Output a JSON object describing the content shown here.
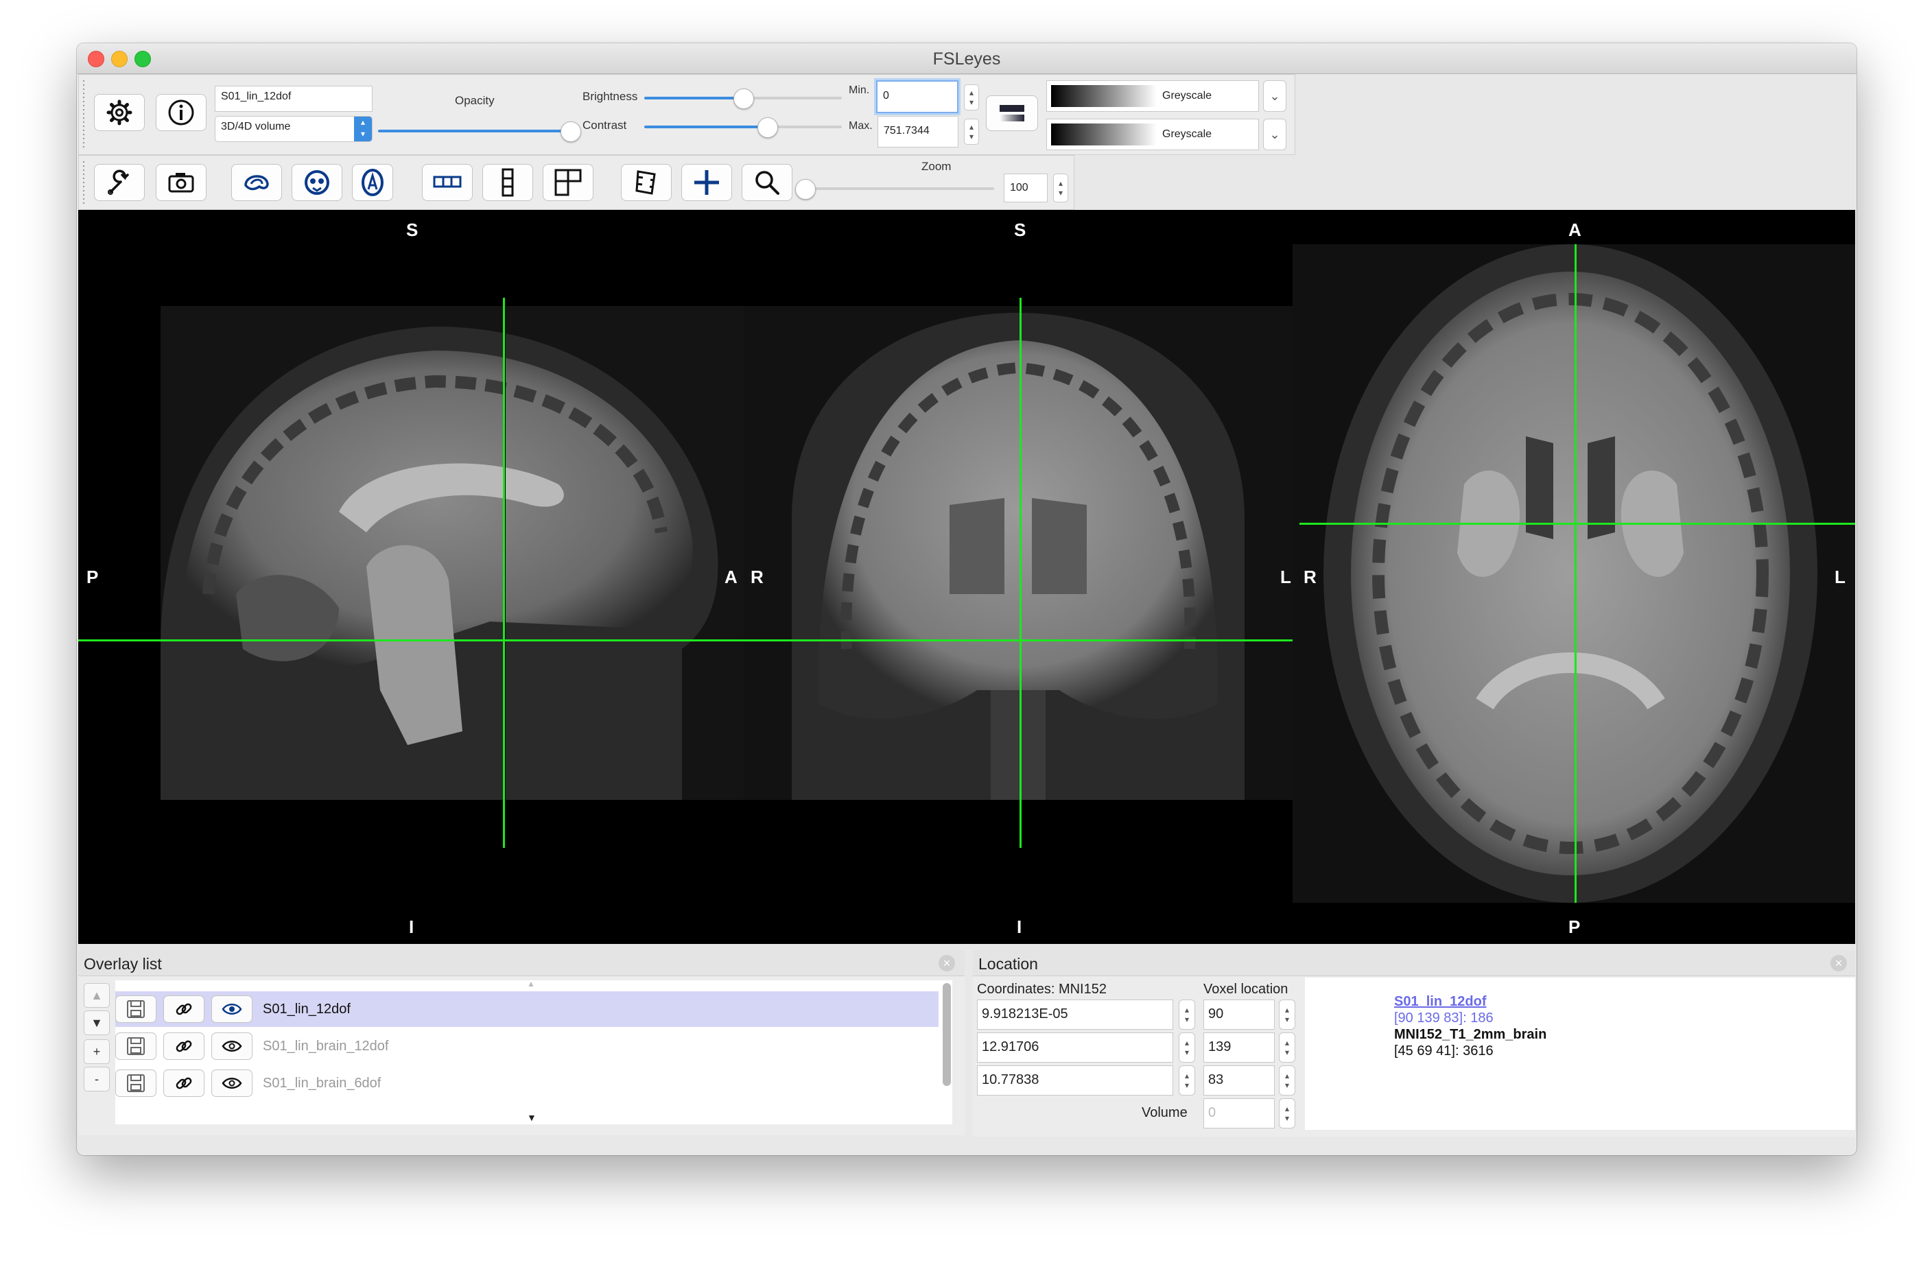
{
  "window": {
    "title": "FSLeyes"
  },
  "overlay_toolbar": {
    "overlay_name": "S01_lin_12dof",
    "overlay_type": "3D/4D volume",
    "opacity_label": "Opacity",
    "opacity_level": 1.0,
    "brightness_label": "Brightness",
    "brightness_level": 0.5,
    "contrast_label": "Contrast",
    "contrast_level": 0.62,
    "min_label": "Min.",
    "min_value": "0",
    "max_label": "Max.",
    "max_value": "751.7344",
    "cmap1": "Greyscale",
    "cmap2": "Greyscale"
  },
  "view_toolbar": {
    "zoom_label": "Zoom",
    "zoom_value": "100",
    "zoom_level": 0.0,
    "icons": [
      "wrench-icon",
      "camera-icon",
      "sagittal-icon",
      "coronal-icon",
      "axial-icon",
      "horizontal-layout-icon",
      "vertical-layout-icon",
      "grid-layout-icon",
      "movie-icon",
      "crosshair-icon",
      "zoom-icon"
    ]
  },
  "views": {
    "sagittal": {
      "top": "S",
      "bottom": "I",
      "left": "P",
      "right": "A"
    },
    "coronal": {
      "top": "S",
      "bottom": "I",
      "left": "R",
      "right": "L"
    },
    "axial": {
      "top": "A",
      "bottom": "P",
      "left": "R",
      "right": "L"
    }
  },
  "overlay_list": {
    "title": "Overlay list",
    "items": [
      {
        "name": "S01_lin_12dof",
        "selected": true
      },
      {
        "name": "S01_lin_brain_12dof",
        "selected": false
      },
      {
        "name": "S01_lin_brain_6dof",
        "selected": false
      }
    ],
    "side_buttons": [
      "▲",
      "▼",
      "+",
      "-"
    ]
  },
  "location": {
    "title": "Location",
    "coords_label": "Coordinates: MNI152",
    "voxel_label": "Voxel location",
    "coords": [
      "9.918213E-05",
      "12.91706",
      "10.77838"
    ],
    "voxels": [
      "90",
      "139",
      "83"
    ],
    "volume_label": "Volume",
    "volume_value": "0",
    "info": {
      "line1": "S01_lin_12dof",
      "line2": "[90 139 83]: 186",
      "line3": "MNI152_T1_2mm_brain",
      "line4": "[45 69 41]: 3616"
    }
  },
  "colors": {
    "crosshair": "#1ee61e",
    "accent": "#3b8de0",
    "info_highlight": "#6a6ae8",
    "selected_row": "#d5d5f5"
  }
}
